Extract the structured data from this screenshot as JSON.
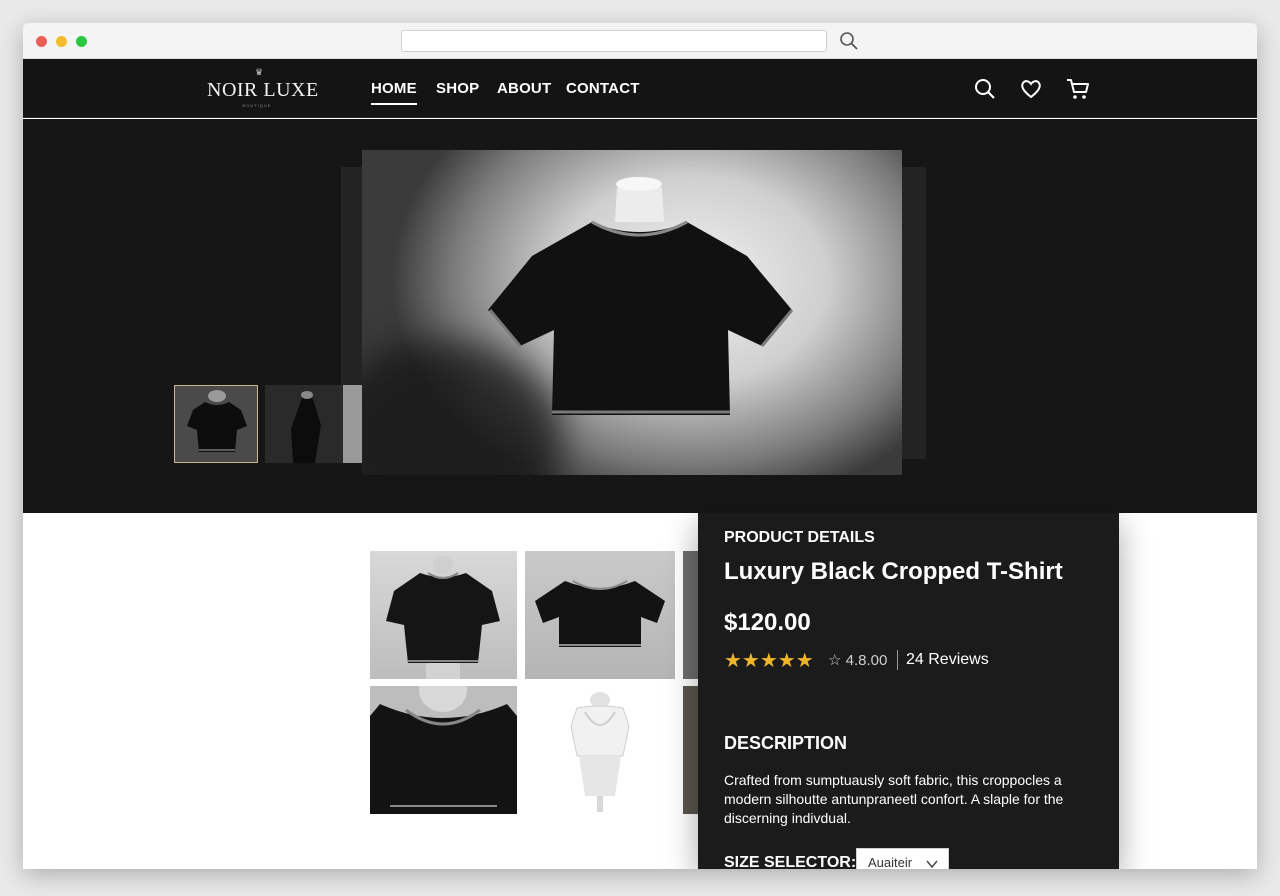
{
  "brand": {
    "name": "NOIR LUXE",
    "sub": "BOUTIQUE"
  },
  "nav": {
    "links": [
      "HOME",
      "SHOP",
      "ABOUT",
      "CONTACT"
    ],
    "active": "HOME"
  },
  "icons": [
    "search-icon",
    "heart-icon",
    "cart-icon"
  ],
  "product": {
    "kicker": "PRODUCT DETAILS",
    "title": "Luxury Black Cropped T-Shirt",
    "price": "$120.00",
    "stars": "★★★★★",
    "rating": "☆ 4.8.00",
    "reviews": "24 Reviews",
    "description_heading": "DESCRIPTION",
    "description": "Crafted from sumptuausly soft fabric, this croppocles a modern silhoutte antunpraneetl confort. A slaple for the discerning indivdual.",
    "size_label": "SIZE SELECTOR:",
    "size_value": "Auaiteir"
  },
  "colors": {
    "accent": "#f1b52c",
    "dark": "#141414",
    "panel": "#1b1b1b"
  }
}
